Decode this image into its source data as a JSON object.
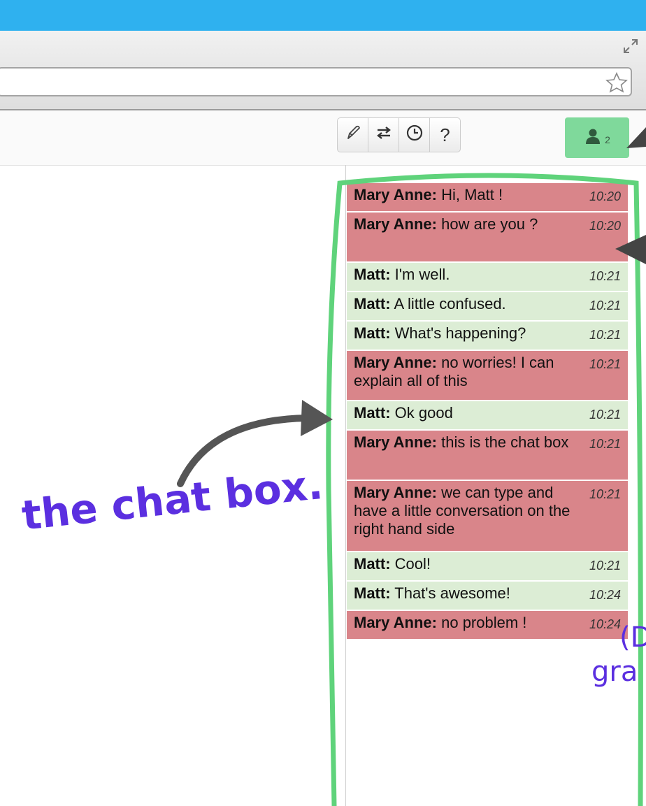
{
  "colors": {
    "title_bar": "#2fb1ef",
    "users_button": "#7fd99b",
    "mary_bubble": "#d9858a",
    "matt_bubble": "#dcedd5",
    "annotation_outline": "#5fd37b",
    "annotation_text": "#5b2fe0",
    "annotation_arrow": "#555555"
  },
  "toolbar": {
    "tools": [
      {
        "icon": "pencil-icon"
      },
      {
        "icon": "swap-arrows-icon"
      },
      {
        "icon": "clock-icon"
      },
      {
        "icon": "help-icon",
        "label": "?"
      }
    ],
    "users_icon": "user-icon",
    "users_count": "2"
  },
  "chat": {
    "messages": [
      {
        "author": "Mary Anne:",
        "text": "Hi, Matt !",
        "time": "10:20",
        "sender": "mary"
      },
      {
        "author": "Mary Anne:",
        "text": "how are you ?",
        "time": "10:20",
        "sender": "mary"
      },
      {
        "author": "Matt:",
        "text": "I'm well.",
        "time": "10:21",
        "sender": "matt"
      },
      {
        "author": "Matt:",
        "text": "A little confused.",
        "time": "10:21",
        "sender": "matt"
      },
      {
        "author": "Matt:",
        "text": "What's happening?",
        "time": "10:21",
        "sender": "matt"
      },
      {
        "author": "Mary Anne:",
        "text": "no worries! I can explain all of this",
        "time": "10:21",
        "sender": "mary"
      },
      {
        "author": "Matt:",
        "text": "Ok good",
        "time": "10:21",
        "sender": "matt"
      },
      {
        "author": "Mary Anne:",
        "text": "this is the chat box",
        "time": "10:21",
        "sender": "mary"
      },
      {
        "author": "Mary Anne:",
        "text": "we can type and have a little conversation on the right hand side",
        "time": "10:21",
        "sender": "mary"
      },
      {
        "author": "Matt:",
        "text": "Cool!",
        "time": "10:21",
        "sender": "matt"
      },
      {
        "author": "Matt:",
        "text": "That's awesome!",
        "time": "10:24",
        "sender": "matt"
      },
      {
        "author": "Mary Anne:",
        "text": "no problem !",
        "time": "10:24",
        "sender": "mary"
      }
    ]
  },
  "annotations": {
    "label": "the chat box.",
    "side_text_1": "(D",
    "side_text_2": "gra"
  }
}
